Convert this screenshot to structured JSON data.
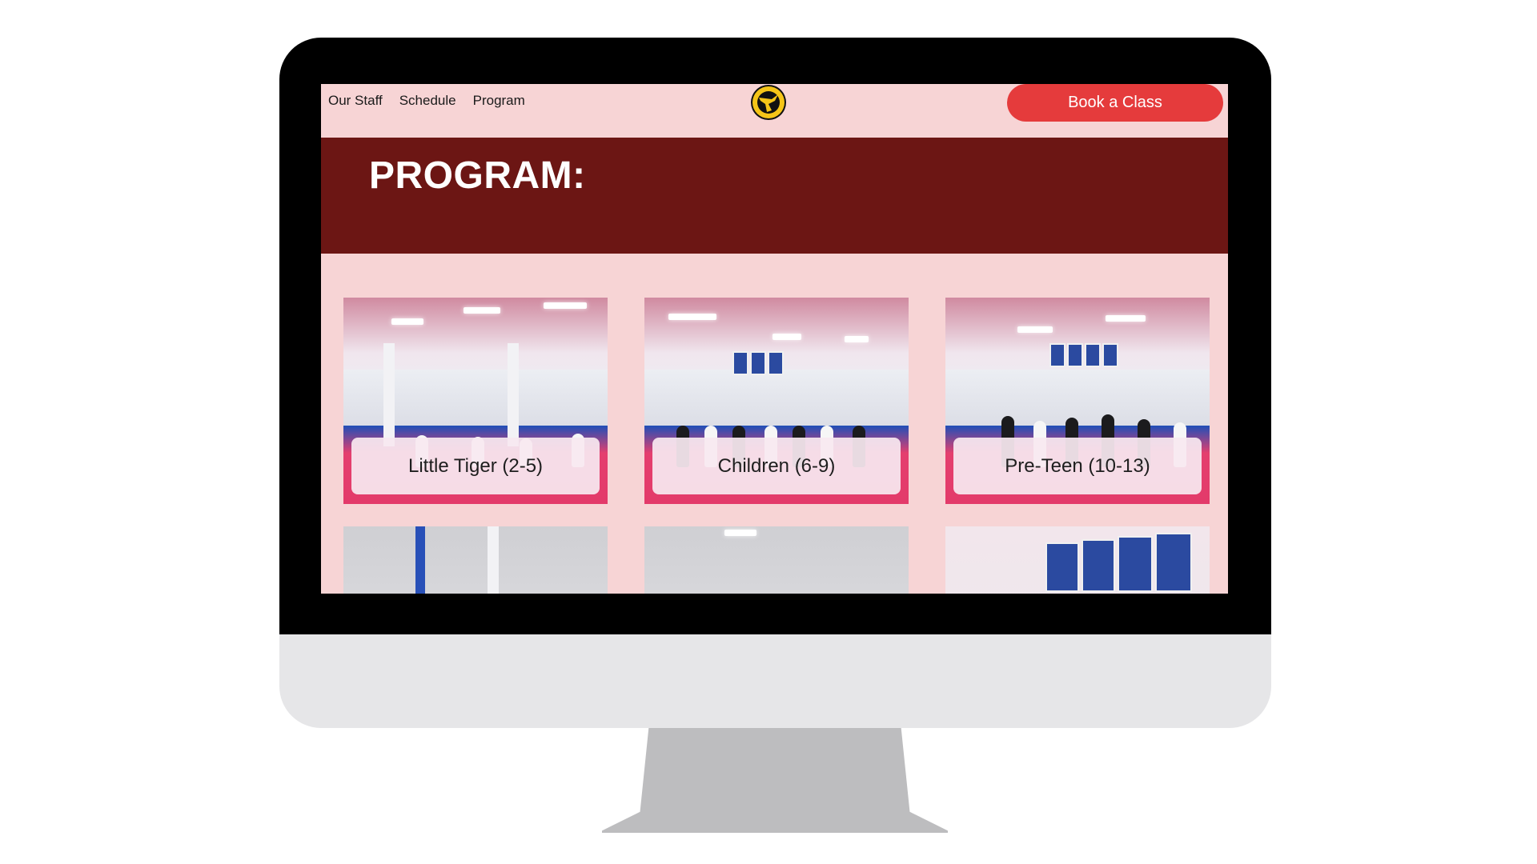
{
  "nav": {
    "links": [
      "Our Staff",
      "Schedule",
      "Program"
    ],
    "logo_icon": "kick-logo-icon",
    "book_label": "Book a Class"
  },
  "hero": {
    "title": "PROGRAM:"
  },
  "programs": [
    {
      "label": "Little Tiger (2-5)"
    },
    {
      "label": "Children (6-9)"
    },
    {
      "label": "Pre-Teen (10-13)"
    }
  ],
  "colors": {
    "page_bg": "#f7d4d5",
    "hero_bg": "#6c1614",
    "button_bg": "#e53b3c",
    "monitor_frame": "#000000",
    "monitor_chin": "#e6e6e8",
    "monitor_stand": "#bdbdbf"
  }
}
